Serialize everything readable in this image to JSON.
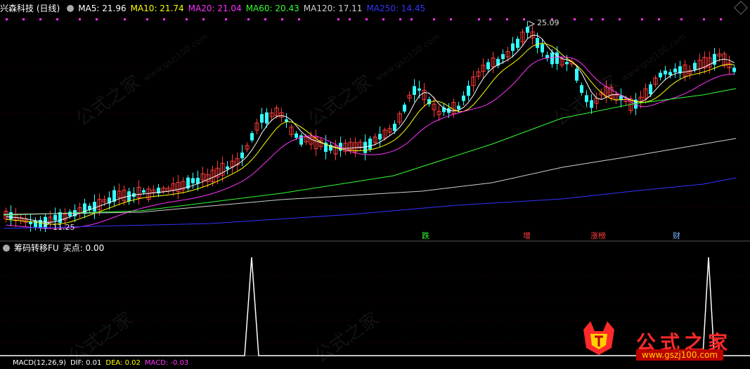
{
  "main_panel": {
    "stock_title": "兴森科技 (日线)",
    "ma": [
      {
        "label": "MA5: 21.96",
        "color": "#ffffff"
      },
      {
        "label": "MA10: 21.74",
        "color": "#ffff00"
      },
      {
        "label": "MA20: 21.04",
        "color": "#ff33ff"
      },
      {
        "label": "MA60: 20.43",
        "color": "#33ff33"
      },
      {
        "label": "MA120: 17.11",
        "color": "#cfcfcf"
      },
      {
        "label": "MA250: 14.45",
        "color": "#3333ff"
      }
    ],
    "high_label": "25.09",
    "low_label": "11.25",
    "badges": [
      {
        "text": "跌",
        "color": "#33ff33"
      },
      {
        "text": "增",
        "color": "#ff4040"
      },
      {
        "text": "涨榜",
        "color": "#ff4040"
      },
      {
        "text": "财",
        "color": "#7fb7ff"
      }
    ]
  },
  "sub_panel": {
    "title": "筹码转移FU",
    "value": "买点: 0.00"
  },
  "bottom_panel": {
    "title": "MACD(12,26,9)",
    "dif": "DIF: 0.01",
    "dea": "DEA: 0.02",
    "macd": "MACD: -0.03"
  },
  "watermark": {
    "brand": "公式之家",
    "url": "www.gszj100.com"
  },
  "colors": {
    "up": "#ff3b3b",
    "down": "#33ffff",
    "background": "#000000",
    "grid": "#2a0000"
  }
}
